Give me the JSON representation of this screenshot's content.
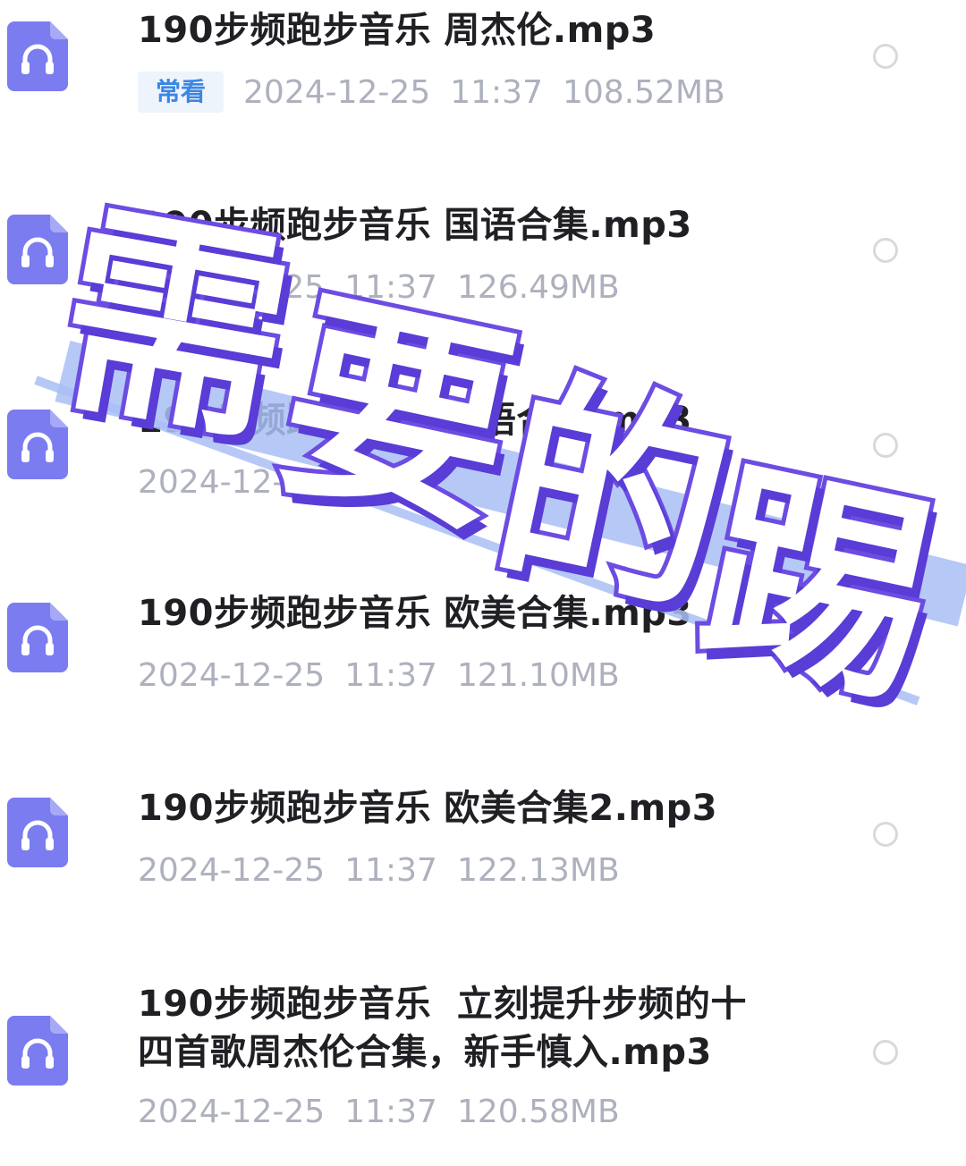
{
  "files": [
    {
      "title": "190步频跑步音乐 周杰伦.mp3",
      "tag": "常看",
      "date": "2024-12-25",
      "time": "11:37",
      "size": "108.52MB",
      "icon": "headphones-file-icon"
    },
    {
      "title": "190步频跑步音乐 国语合集.mp3",
      "date": "2024-12-25",
      "time": "11:37",
      "size": "126.49MB",
      "icon": "headphones-file-icon"
    },
    {
      "title": "190步频跑步音乐 粤语合集.mp3",
      "date": "2024-12-25",
      "time": "11:37",
      "size": "",
      "icon": "headphones-file-icon"
    },
    {
      "title": "190步频跑步音乐 欧美合集.mp3",
      "date": "2024-12-25",
      "time": "11:37",
      "size": "121.10MB",
      "icon": "headphones-file-icon"
    },
    {
      "title": "190步频跑步音乐 欧美合集2.mp3",
      "date": "2024-12-25",
      "time": "11:37",
      "size": "122.13MB",
      "icon": "headphones-file-icon"
    },
    {
      "title": "190步频跑步音乐  立刻提升步频的十\n四首歌周杰伦合集，新手慎入.mp3",
      "date": "2024-12-25",
      "time": "11:37",
      "size": "120.58MB",
      "icon": "headphones-file-icon"
    }
  ],
  "overlay": {
    "chars": [
      "需",
      "要",
      "的",
      "踢"
    ],
    "stroke_color": "#6c4ce2",
    "stripe_color": "#a9bff4"
  },
  "colors": {
    "icon_purple": "#7a7cf0",
    "tag_blue": "#3b86e6",
    "meta_gray": "#aeb1bd"
  }
}
